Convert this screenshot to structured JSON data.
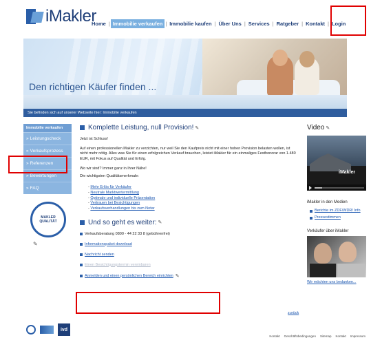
{
  "brand": {
    "name": "iMakler"
  },
  "topnav": {
    "items": [
      {
        "label": "Home"
      },
      {
        "label": "Immobilie verkaufen"
      },
      {
        "label": "Immobilie kaufen"
      },
      {
        "label": "Über Uns"
      },
      {
        "label": "Services"
      },
      {
        "label": "Ratgeber"
      },
      {
        "label": "Kontakt"
      },
      {
        "label": "Login"
      }
    ],
    "separator": "|"
  },
  "hero": {
    "headline": "Den richtigen Käufer finden ..."
  },
  "breadcrumb": "Sie befinden sich auf unserer Webseite hier: Immobilie verkaufen",
  "leftnav": {
    "heading": "Immobilie verkaufen",
    "items": [
      {
        "label": "Leistungscheck"
      },
      {
        "label": "Verkaufsprozess"
      },
      {
        "label": "Referenzen"
      },
      {
        "label": "Bewertungen"
      },
      {
        "label": "FAQ"
      }
    ],
    "seal_text": "MAKLER QUALITÄT"
  },
  "main": {
    "heading1": "Komplette Leistung, null Provision!",
    "intro": "Jetzt ist Schluss!",
    "paragraph": "Auf einen professionellen Makler zu verzichten, nur weil Sie den Kaufpreis nicht mit einer hohen Provision belasten wollen, ist nicht mehr nötig. Alles was Sie für einen erfolgreichen Verkauf brauchen, leistet iMakler für ein einmaliges Festhonorar von 1.480 EUR, mit Fokus auf Qualität und Erfolg.",
    "q1": "Wo wir sind? Immer ganz in Ihrer Nähe!",
    "q2": "Die wichtigsten Qualitätsmerkmale:",
    "features": [
      "Mehr Erlös für Verkäufer",
      "Neutrale Marktwertermittlung",
      "Optimale und individuelle Präsentation",
      "Vertrauen bei Besichtigungen",
      "Verkaufsverhandlungen bis zum Notar"
    ],
    "heading2": "Und so geht es weiter:",
    "steps": [
      {
        "text": "Verkaufsberatung 0800 - 44 22 33 8 (gebührenfrei)",
        "link": false,
        "faint": false
      },
      {
        "text": "Informationspaket download",
        "link": true,
        "faint": false
      },
      {
        "text": "Nachricht senden",
        "link": true,
        "faint": false
      },
      {
        "text": "Einen Besichtigungstermin vereinbaren",
        "link": true,
        "faint": true
      },
      {
        "text": "Anmelden und einen persönlichen Bereich einrichten",
        "link": true,
        "faint": false
      }
    ],
    "back_link": "zurück"
  },
  "right": {
    "video_title": "Video",
    "video_logo": "iMakler",
    "media_title": "iMakler in den Medien",
    "media_links": [
      "Berichte im ZDF/WDR/ Info",
      "Pressestimmen"
    ],
    "seller_title": "Verkäufer über iMakler",
    "seller_link": "Wir möchten uns bedanken..."
  },
  "footer": {
    "ivd_label": "ivd",
    "links": [
      "Kontakt",
      "Geschäftsbedingungen",
      "Sitemap",
      "Kontakt",
      "Impressum"
    ]
  },
  "colors": {
    "brand_blue": "#1e3e78",
    "accent_blue": "#2a5ea8",
    "nav_blue": "#8bb5e0",
    "annotation_red": "#e00000"
  }
}
